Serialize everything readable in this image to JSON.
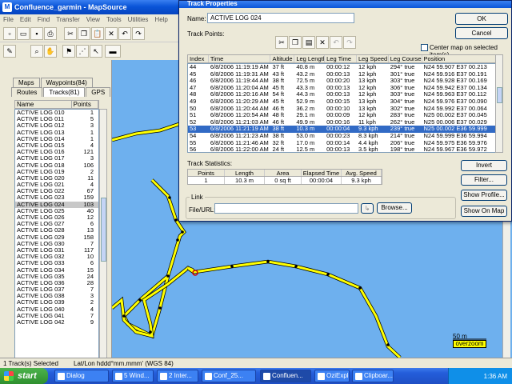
{
  "window": {
    "title": "Confluence_garmin - MapSource"
  },
  "menu": [
    "File",
    "Edit",
    "Find",
    "Transfer",
    "View",
    "Tools",
    "Utilities",
    "Help"
  ],
  "left_tabs_top": [
    "Maps",
    "Waypoints(84)"
  ],
  "left_tabs_bottom": [
    "Routes",
    "Tracks(81)",
    "GPS"
  ],
  "track_list": {
    "columns": [
      "Name",
      "Points"
    ],
    "rows": [
      [
        "ACTIVE LOG 010",
        "1"
      ],
      [
        "ACTIVE LOG 011",
        "5"
      ],
      [
        "ACTIVE LOG 012",
        "3"
      ],
      [
        "ACTIVE LOG 013",
        "1"
      ],
      [
        "ACTIVE LOG 014",
        "1"
      ],
      [
        "ACTIVE LOG 015",
        "4"
      ],
      [
        "ACTIVE LOG 016",
        "121"
      ],
      [
        "ACTIVE LOG 017",
        "3"
      ],
      [
        "ACTIVE LOG 018",
        "106"
      ],
      [
        "ACTIVE LOG 019",
        "2"
      ],
      [
        "ACTIVE LOG 020",
        "11"
      ],
      [
        "ACTIVE LOG 021",
        "4"
      ],
      [
        "ACTIVE LOG 022",
        "67"
      ],
      [
        "ACTIVE LOG 023",
        "159"
      ],
      [
        "ACTIVE LOG 024",
        "103"
      ],
      [
        "ACTIVE LOG 025",
        "40"
      ],
      [
        "ACTIVE LOG 026",
        "12"
      ],
      [
        "ACTIVE LOG 027",
        "6"
      ],
      [
        "ACTIVE LOG 028",
        "13"
      ],
      [
        "ACTIVE LOG 029",
        "158"
      ],
      [
        "ACTIVE LOG 030",
        "7"
      ],
      [
        "ACTIVE LOG 031",
        "117"
      ],
      [
        "ACTIVE LOG 032",
        "10"
      ],
      [
        "ACTIVE LOG 033",
        "6"
      ],
      [
        "ACTIVE LOG 034",
        "15"
      ],
      [
        "ACTIVE LOG 035",
        "24"
      ],
      [
        "ACTIVE LOG 036",
        "28"
      ],
      [
        "ACTIVE LOG 037",
        "7"
      ],
      [
        "ACTIVE LOG 038",
        "3"
      ],
      [
        "ACTIVE LOG 039",
        "2"
      ],
      [
        "ACTIVE LOG 040",
        "4"
      ],
      [
        "ACTIVE LOG 041",
        "7"
      ],
      [
        "ACTIVE LOG 042",
        "9"
      ]
    ],
    "selected_index": 14
  },
  "map": {
    "scale_label": "50 m",
    "overzoom_label": "overzoom"
  },
  "status": {
    "selection": "1 Track(s) Selected",
    "format": "Lat/Lon hddd°mm.mmm' (WGS 84)"
  },
  "dialog": {
    "title": "Track Properties",
    "name_label": "Name:",
    "name_value": "ACTIVE LOG 024",
    "ok": "OK",
    "cancel": "Cancel",
    "track_points_label": "Track Points:",
    "center_map_label": "Center map on selected item(s)",
    "columns": [
      "Index",
      "Time",
      "Altitude",
      "Leg Length",
      "Leg Time",
      "Leg Speed",
      "Leg Course",
      "Position"
    ],
    "points": [
      [
        "44",
        "6/8/2006 11:19:19 AM",
        "37 ft",
        "40.8 m",
        "00:00:12",
        "12 kph",
        "294° true",
        "N24 59.907 E37 00.213"
      ],
      [
        "45",
        "6/8/2006 11:19:31 AM",
        "43 ft",
        "43.2 m",
        "00:00:13",
        "12 kph",
        "301° true",
        "N24 59.916 E37 00.191"
      ],
      [
        "46",
        "6/8/2006 11:19:44 AM",
        "38 ft",
        "72.5 m",
        "00:00:20",
        "13 kph",
        "303° true",
        "N24 59.928 E37 00.169"
      ],
      [
        "47",
        "6/8/2006 11:20:04 AM",
        "45 ft",
        "43.3 m",
        "00:00:13",
        "12 kph",
        "306° true",
        "N24 59.942 E37 00.134"
      ],
      [
        "48",
        "6/8/2006 11:20:16 AM",
        "54 ft",
        "44.3 m",
        "00:00:13",
        "12 kph",
        "303° true",
        "N24 59.963 E37 00.112"
      ],
      [
        "49",
        "6/8/2006 11:20:29 AM",
        "45 ft",
        "52.9 m",
        "00:00:15",
        "13 kph",
        "304° true",
        "N24 59.976 E37 00.090"
      ],
      [
        "50",
        "6/8/2006 11:20:44 AM",
        "46 ft",
        "36.2 m",
        "00:00:10",
        "13 kph",
        "302° true",
        "N24 59.992 E37 00.064"
      ],
      [
        "51",
        "6/8/2006 11:20:54 AM",
        "48 ft",
        "29.1 m",
        "00:00:09",
        "12 kph",
        "283° true",
        "N25 00.002 E37 00.045"
      ],
      [
        "52",
        "6/8/2006 11:21:03 AM",
        "46 ft",
        "49.9 m",
        "00:00:16",
        "11 kph",
        "262° true",
        "N25 00.006 E37 00.029"
      ],
      [
        "53",
        "6/8/2006 11:21:19 AM",
        "38 ft",
        "10.3 m",
        "00:00:04",
        "9.3 kph",
        "239° true",
        "N25 00.002 E36 59.999"
      ],
      [
        "54",
        "6/8/2006 11:21:23 AM",
        "38 ft",
        "53.0 m",
        "00:00:23",
        "8.3 kph",
        "214° true",
        "N24 59.999 E36 59.994"
      ],
      [
        "55",
        "6/8/2006 11:21:46 AM",
        "32 ft",
        "17.0 m",
        "00:00:14",
        "4.4 kph",
        "206° true",
        "N24 59.975 E36 59.976"
      ],
      [
        "56",
        "6/8/2006 11:22:00 AM",
        "24 ft",
        "12.5 m",
        "00:00:13",
        "3.5 kph",
        "198° true",
        "N24 59.967 E36 59.972"
      ]
    ],
    "selected_point": 9,
    "stats_label": "Track Statistics:",
    "stats_columns": [
      "Points",
      "Length",
      "Area",
      "Elapsed Time",
      "Avg. Speed"
    ],
    "stats_values": [
      "1",
      "10.3 m",
      "0 sq ft",
      "00:00:04",
      "9.3 kph"
    ],
    "link_label": "Link",
    "file_url_label": "File/URL:",
    "browse": "Browse...",
    "invert": "Invert",
    "filter": "Filter...",
    "show_profile": "Show Profile...",
    "show_on_map": "Show On Map"
  },
  "taskbar": {
    "start": "start",
    "tasks": [
      "Dialog",
      "5 Wind...",
      "2 Inter...",
      "Conf_25...",
      "Confluen...",
      "OziExplorer",
      "Clipboar..."
    ],
    "active_task": 4,
    "clock": "1:36 AM"
  }
}
